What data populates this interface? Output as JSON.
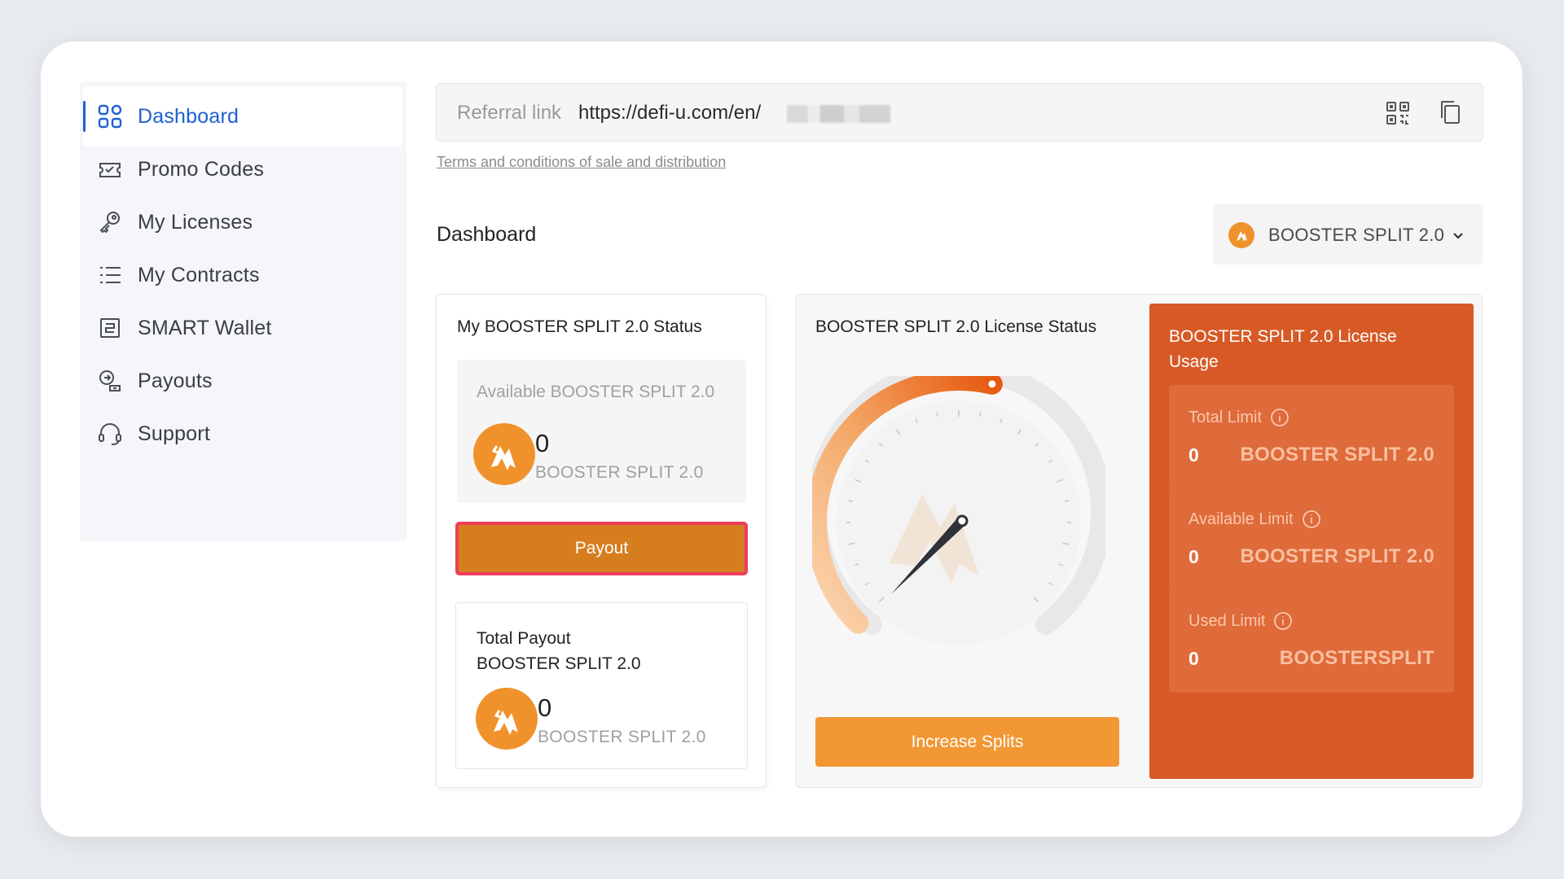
{
  "sidebar": {
    "items": [
      {
        "label": "Dashboard",
        "icon": "dashboard-grid-icon",
        "active": true
      },
      {
        "label": "Promo Codes",
        "icon": "ticket-icon"
      },
      {
        "label": "My Licenses",
        "icon": "key-icon"
      },
      {
        "label": "My Contracts",
        "icon": "list-icon"
      },
      {
        "label": "SMART Wallet",
        "icon": "wallet-icon"
      },
      {
        "label": "Payouts",
        "icon": "payout-icon"
      },
      {
        "label": "Support",
        "icon": "headset-icon"
      }
    ]
  },
  "referral": {
    "label": "Referral link",
    "url": "https://defi-u.com/en/",
    "terms_link": "Terms and conditions of sale and distribution"
  },
  "dashboard": {
    "title": "Dashboard",
    "product_selector": "BOOSTER SPLIT 2.0"
  },
  "status_card": {
    "title": "My BOOSTER SPLIT 2.0 Status",
    "available_label": "Available BOOSTER SPLIT 2.0",
    "available_value": "0",
    "available_unit": "BOOSTER SPLIT 2.0",
    "payout_button": "Payout",
    "total_payout_label_line1": "Total Payout",
    "total_payout_label_line2": "BOOSTER SPLIT 2.0",
    "total_payout_value": "0",
    "total_payout_unit": "BOOSTER SPLIT 2.0"
  },
  "license_status": {
    "title": "BOOSTER SPLIT 2.0 License Status",
    "gauge_fill_fraction": 0.55,
    "increase_button": "Increase Splits"
  },
  "license_usage": {
    "title": "BOOSTER SPLIT 2.0 License Usage",
    "limits": [
      {
        "label": "Total Limit",
        "value": "0",
        "unit": "BOOSTER SPLIT 2.0"
      },
      {
        "label": "Available Limit",
        "value": "0",
        "unit": "BOOSTER SPLIT 2.0"
      },
      {
        "label": "Used Limit",
        "value": "0",
        "unit": "BOOSTERSPLIT"
      }
    ]
  },
  "colors": {
    "accent_blue": "#1f5fd4",
    "payout_orange": "#d67d1e",
    "payout_border": "#ee3c5f",
    "increase_orange": "#f19734",
    "usage_panel": "#d75a26"
  }
}
